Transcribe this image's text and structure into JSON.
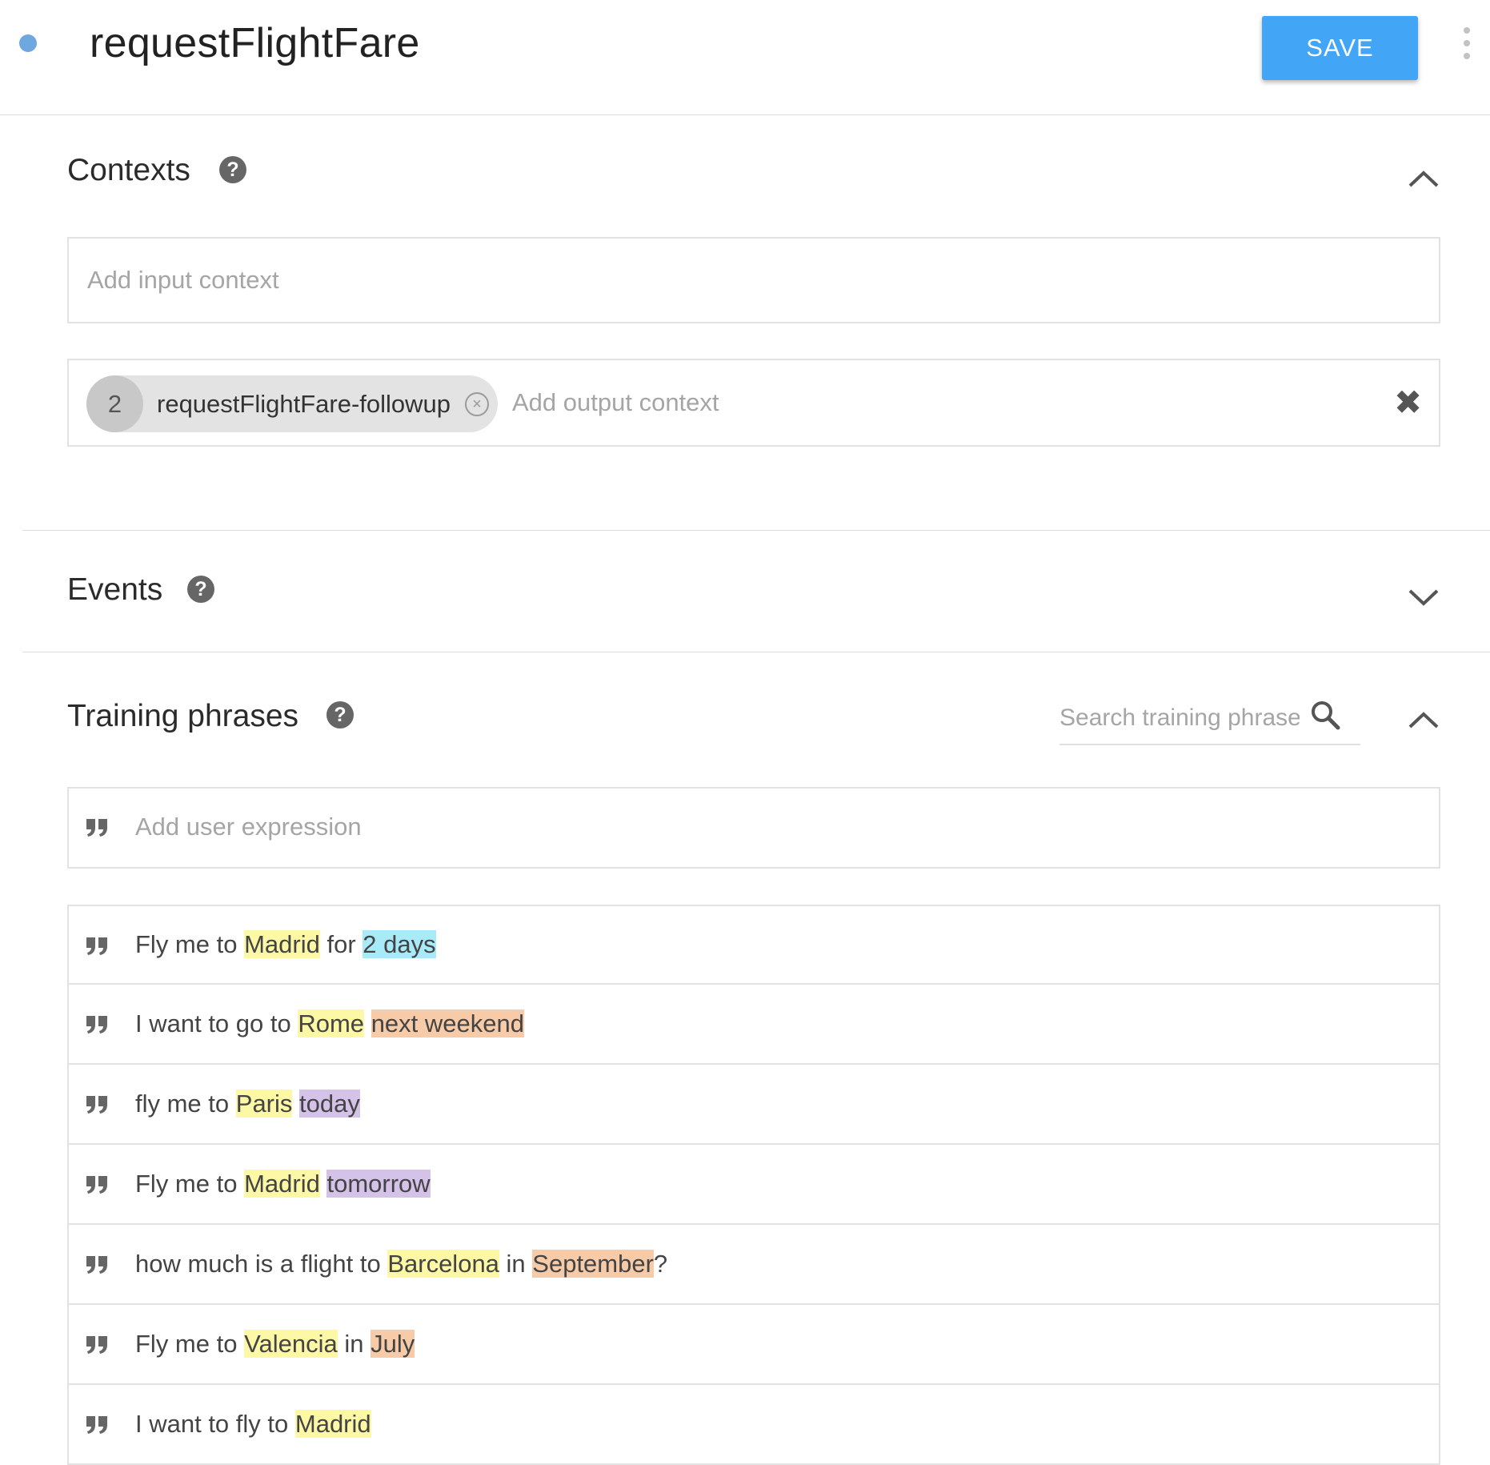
{
  "header": {
    "title": "requestFlightFare",
    "save_label": "SAVE"
  },
  "contexts": {
    "title": "Contexts",
    "input_placeholder": "Add input context",
    "output_chip": {
      "count": "2",
      "label": "requestFlightFare-followup"
    },
    "output_placeholder": "Add output context"
  },
  "events": {
    "title": "Events"
  },
  "training": {
    "title": "Training phrases",
    "search_placeholder": "Search training phrases",
    "add_placeholder": "Add user expression",
    "phrases": [
      [
        {
          "t": "Fly me to "
        },
        {
          "t": "Madrid",
          "hl": "yellow"
        },
        {
          "t": " for "
        },
        {
          "t": "2 days",
          "hl": "blue"
        }
      ],
      [
        {
          "t": "I want to go to "
        },
        {
          "t": "Rome",
          "hl": "yellow"
        },
        {
          "t": " "
        },
        {
          "t": "next weekend",
          "hl": "orange"
        }
      ],
      [
        {
          "t": "fly me to "
        },
        {
          "t": "Paris",
          "hl": "yellow"
        },
        {
          "t": " "
        },
        {
          "t": "today",
          "hl": "purple"
        }
      ],
      [
        {
          "t": "Fly me to "
        },
        {
          "t": "Madrid",
          "hl": "yellow"
        },
        {
          "t": " "
        },
        {
          "t": "tomorrow",
          "hl": "purple"
        }
      ],
      [
        {
          "t": "how much is a flight to "
        },
        {
          "t": "Barcelona",
          "hl": "yellow"
        },
        {
          "t": " in "
        },
        {
          "t": "September",
          "hl": "orange"
        },
        {
          "t": "?"
        }
      ],
      [
        {
          "t": "Fly me to "
        },
        {
          "t": "Valencia",
          "hl": "yellow"
        },
        {
          "t": " in "
        },
        {
          "t": "July",
          "hl": "orange"
        }
      ],
      [
        {
          "t": "I want to fly to "
        },
        {
          "t": "Madrid",
          "hl": "yellow"
        }
      ]
    ]
  },
  "icons": {
    "status_dot": "status-dot-icon",
    "menu": "more-vert-icon",
    "help": "help-icon",
    "collapse": "chevron-up-icon",
    "expand": "chevron-down-icon",
    "search": "search-icon",
    "quote": "quote-icon",
    "remove": "close-circle-icon",
    "clear": "close-icon"
  },
  "colors": {
    "accent": "#42a5f5",
    "status_dot": "#6fa8e0",
    "entity_location": "#fdf8a6",
    "entity_duration": "#a8eaf8",
    "entity_date_period": "#f8cba8",
    "entity_date": "#d4c2e8"
  }
}
